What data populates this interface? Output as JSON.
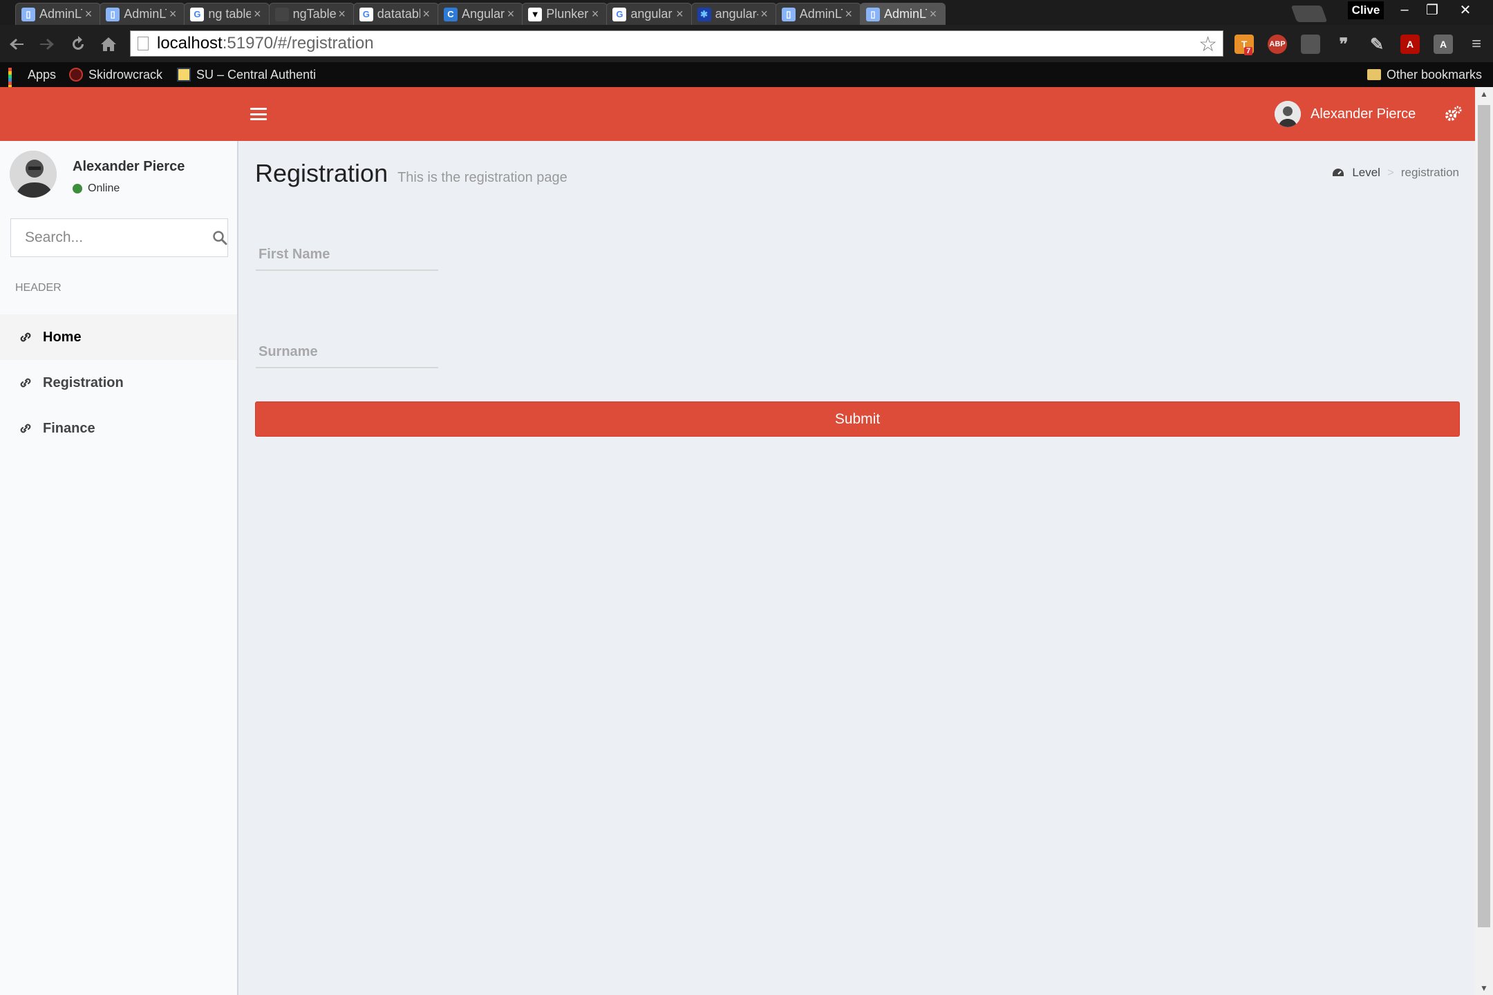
{
  "browser": {
    "tabs": [
      {
        "label": "AdminLTE",
        "favicon": "page"
      },
      {
        "label": "AdminLTE",
        "favicon": "page"
      },
      {
        "label": "ng table -",
        "favicon": "google"
      },
      {
        "label": "ngTable Ex",
        "favicon": "blank"
      },
      {
        "label": "datatables",
        "favicon": "google"
      },
      {
        "label": "AngularJS",
        "favicon": "angularjs"
      },
      {
        "label": "Plunker",
        "favicon": "plunker"
      },
      {
        "label": "angular da",
        "favicon": "google"
      },
      {
        "label": "angular-da",
        "favicon": "star"
      },
      {
        "label": "AdminLTE",
        "favicon": "page"
      },
      {
        "label": "AdminLTE",
        "favicon": "page",
        "active": true
      }
    ],
    "profile_name": "Clive",
    "url_host": "localhost",
    "url_rest": ":51970/#/registration",
    "bookmarks": [
      {
        "label": "Apps",
        "icon": "apps-grid-icon"
      },
      {
        "label": "Skidrowcrack",
        "icon": "skull-icon"
      },
      {
        "label": "SU – Central Authenti",
        "icon": "su-logo-icon"
      }
    ],
    "other_bookmarks": "Other bookmarks",
    "extensions": [
      {
        "name": "todoist-icon",
        "label": "T",
        "badge": "7",
        "color": "#e8912a"
      },
      {
        "name": "adblock-icon",
        "label": "ABP",
        "color": "#c0392b"
      },
      {
        "name": "ghostery-icon",
        "label": "",
        "color": "#555555"
      },
      {
        "name": "quote-icon",
        "label": "❞",
        "color": "#555555"
      },
      {
        "name": "tool-icon",
        "label": "✎",
        "color": "#555555"
      },
      {
        "name": "pdf-icon",
        "label": "A",
        "color": "#b30b00"
      },
      {
        "name": "angular-batarang-icon",
        "label": "A",
        "color": "#666666"
      },
      {
        "name": "chrome-menu-icon",
        "label": "≡",
        "color": "#555555"
      }
    ]
  },
  "app": {
    "accent": "#dd4b39",
    "user_name": "Alexander Pierce",
    "user_status": "Online",
    "search_placeholder": "Search...",
    "menu_header": "HEADER",
    "menu": [
      {
        "label": "Home",
        "active": true
      },
      {
        "label": "Registration",
        "active": false
      },
      {
        "label": "Finance",
        "active": false
      }
    ],
    "page_title": "Registration",
    "page_subtitle": "This is the registration page",
    "breadcrumb": {
      "level": "Level",
      "sep": ">",
      "current": "registration"
    },
    "form": {
      "first_name_placeholder": "First Name",
      "first_name_value": "",
      "surname_placeholder": "Surname",
      "surname_value": "",
      "submit_label": "Submit"
    }
  }
}
